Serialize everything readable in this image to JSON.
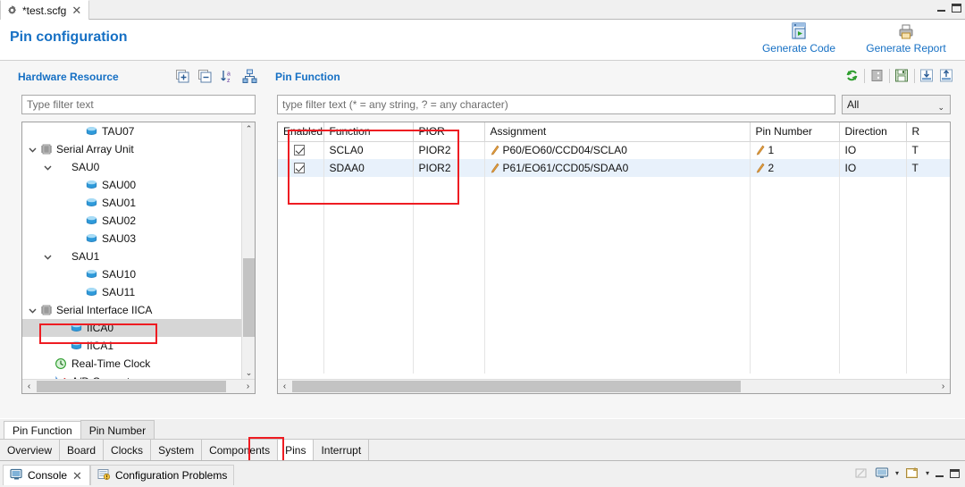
{
  "window": {
    "editor_tab": {
      "title": "*test.scfg",
      "icon": "gear-icon",
      "close": "✕"
    },
    "minimize": "minimize-icon",
    "maximize": "maximize-icon"
  },
  "banner": {
    "title": "Pin configuration",
    "actions": [
      {
        "label": "Generate Code",
        "icon": "generate-code-icon"
      },
      {
        "label": "Generate Report",
        "icon": "generate-report-icon"
      }
    ],
    "accent_color": "#1670c4"
  },
  "hardware_resource": {
    "title": "Hardware Resource",
    "tools": [
      {
        "name": "expand-all-icon",
        "glyph": "+"
      },
      {
        "name": "collapse-all-icon",
        "glyph": "−"
      },
      {
        "name": "sort-az-icon",
        "glyph": "az"
      },
      {
        "name": "show-hierarchy-icon",
        "glyph": "tree"
      }
    ],
    "filter_placeholder": "Type filter text",
    "filter_value": "",
    "tree": [
      {
        "label": "TAU07",
        "indent": 3,
        "twisty": "none",
        "icon": "resource-icon",
        "selected": false
      },
      {
        "label": "Serial Array Unit",
        "indent": 0,
        "twisty": "open",
        "icon": "category-icon",
        "selected": false
      },
      {
        "label": "SAU0",
        "indent": 1,
        "twisty": "open",
        "icon": "none",
        "selected": false
      },
      {
        "label": "SAU00",
        "indent": 3,
        "twisty": "none",
        "icon": "resource-icon",
        "selected": false
      },
      {
        "label": "SAU01",
        "indent": 3,
        "twisty": "none",
        "icon": "resource-icon",
        "selected": false
      },
      {
        "label": "SAU02",
        "indent": 3,
        "twisty": "none",
        "icon": "resource-icon",
        "selected": false
      },
      {
        "label": "SAU03",
        "indent": 3,
        "twisty": "none",
        "icon": "resource-icon",
        "selected": false
      },
      {
        "label": "SAU1",
        "indent": 1,
        "twisty": "open",
        "icon": "none",
        "selected": false
      },
      {
        "label": "SAU10",
        "indent": 3,
        "twisty": "none",
        "icon": "resource-icon",
        "selected": false
      },
      {
        "label": "SAU11",
        "indent": 3,
        "twisty": "none",
        "icon": "resource-icon",
        "selected": false
      },
      {
        "label": "Serial Interface  IICA",
        "indent": 0,
        "twisty": "open",
        "icon": "category-icon",
        "selected": false
      },
      {
        "label": "IICA0",
        "indent": 2,
        "twisty": "none",
        "icon": "resource-selected-icon",
        "selected": true
      },
      {
        "label": "IICA1",
        "indent": 2,
        "twisty": "none",
        "icon": "resource-icon",
        "selected": false
      },
      {
        "label": "Real-Time Clock",
        "indent": 1,
        "twisty": "none",
        "icon": "rtc-icon",
        "selected": false
      },
      {
        "label": "A/D Converter",
        "indent": 1,
        "twisty": "none",
        "icon": "adc-icon",
        "selected": false
      }
    ],
    "scroll": {
      "v_arrow_up": "⌃",
      "v_arrow_down": "⌄",
      "h_arrow_left": "‹",
      "h_arrow_right": "›"
    }
  },
  "pin_function": {
    "title": "Pin Function",
    "tools": [
      {
        "name": "refresh-icon"
      },
      {
        "name": "pin-view-icon"
      },
      {
        "name": "save-icon"
      },
      {
        "name": "import-icon"
      },
      {
        "name": "export-icon"
      }
    ],
    "filter_placeholder": "type filter text (* = any string, ? = any character)",
    "filter_value": "",
    "select_value": "All",
    "select_caret": "⌄",
    "columns": [
      "Enabled",
      "Function",
      "PIOR",
      "Assignment",
      "Pin Number",
      "Direction",
      "R"
    ],
    "rows": [
      {
        "enabled": true,
        "function": "SCLA0",
        "pior": "PIOR2",
        "assignment": "P60/EO60/CCD04/SCLA0",
        "pin_number": "1",
        "direction": "IO",
        "remarks": "T"
      },
      {
        "enabled": true,
        "function": "SDAA0",
        "pior": "PIOR2",
        "assignment": "P61/EO61/CCD05/SDAA0",
        "pin_number": "2",
        "direction": "IO",
        "remarks": "T"
      }
    ],
    "scroll": {
      "h_arrow_left": "‹",
      "h_arrow_right": "›"
    }
  },
  "view_tabs": [
    {
      "label": "Pin Function",
      "active": true
    },
    {
      "label": "Pin Number",
      "active": false
    }
  ],
  "perspective_tabs": [
    {
      "label": "Overview",
      "active": false,
      "highlighted": false
    },
    {
      "label": "Board",
      "active": false,
      "highlighted": false
    },
    {
      "label": "Clocks",
      "active": false,
      "highlighted": false
    },
    {
      "label": "System",
      "active": false,
      "highlighted": false
    },
    {
      "label": "Components",
      "active": false,
      "highlighted": false
    },
    {
      "label": "Pins",
      "active": true,
      "highlighted": true
    },
    {
      "label": "Interrupt",
      "active": false,
      "highlighted": false
    }
  ],
  "console": {
    "tabs": [
      {
        "label": "Console",
        "icon": "console-icon",
        "close": "✕",
        "active": true
      },
      {
        "label": "Configuration Problems",
        "icon": "problems-icon",
        "close": "",
        "active": false
      }
    ],
    "tools": [
      {
        "name": "clear-console-icon"
      },
      {
        "name": "display-console-icon"
      },
      {
        "name": "display-console-caret",
        "glyph": "▾"
      },
      {
        "name": "open-console-icon"
      },
      {
        "name": "open-console-caret",
        "glyph": "▾"
      },
      {
        "name": "minimize-icon"
      },
      {
        "name": "maximize-icon"
      }
    ]
  },
  "annotations": {
    "color": "#ee1c22",
    "boxes": [
      {
        "name": "iica0-highlight"
      },
      {
        "name": "table-columns-highlight"
      },
      {
        "name": "pins-tab-highlight"
      }
    ]
  }
}
